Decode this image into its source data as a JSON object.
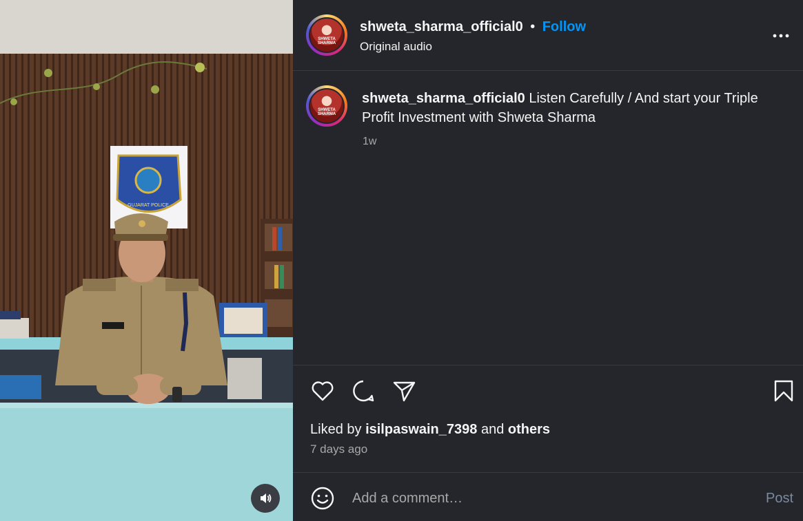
{
  "post": {
    "username": "shweta_sharma_official0",
    "separator": "•",
    "follow_label": "Follow",
    "audio_label": "Original audio",
    "more_label": "•••",
    "avatar_brand": "SHWETA SHARMA"
  },
  "caption": {
    "username": "shweta_sharma_official0",
    "text": "Listen Carefully / And start your Triple Profit Investment with Shweta Sharma",
    "time": "1w"
  },
  "actions": {
    "like_icon": "heart-icon",
    "comment_icon": "comment-icon",
    "share_icon": "send-icon",
    "save_icon": "bookmark-icon"
  },
  "likes": {
    "prefix": "Liked by",
    "user": "isilpaswain_7398",
    "connector": "and",
    "others": "others",
    "date": "7 days ago"
  },
  "comment": {
    "placeholder": "Add a comment…",
    "post_label": "Post",
    "emoji_icon": "smiley-icon"
  },
  "video": {
    "audio_icon": "speaker-icon",
    "badge_text": "GUJARAT POLICE"
  },
  "colors": {
    "panel_bg": "#25262b",
    "accent": "#0095f6",
    "muted": "#a8a8a8"
  }
}
